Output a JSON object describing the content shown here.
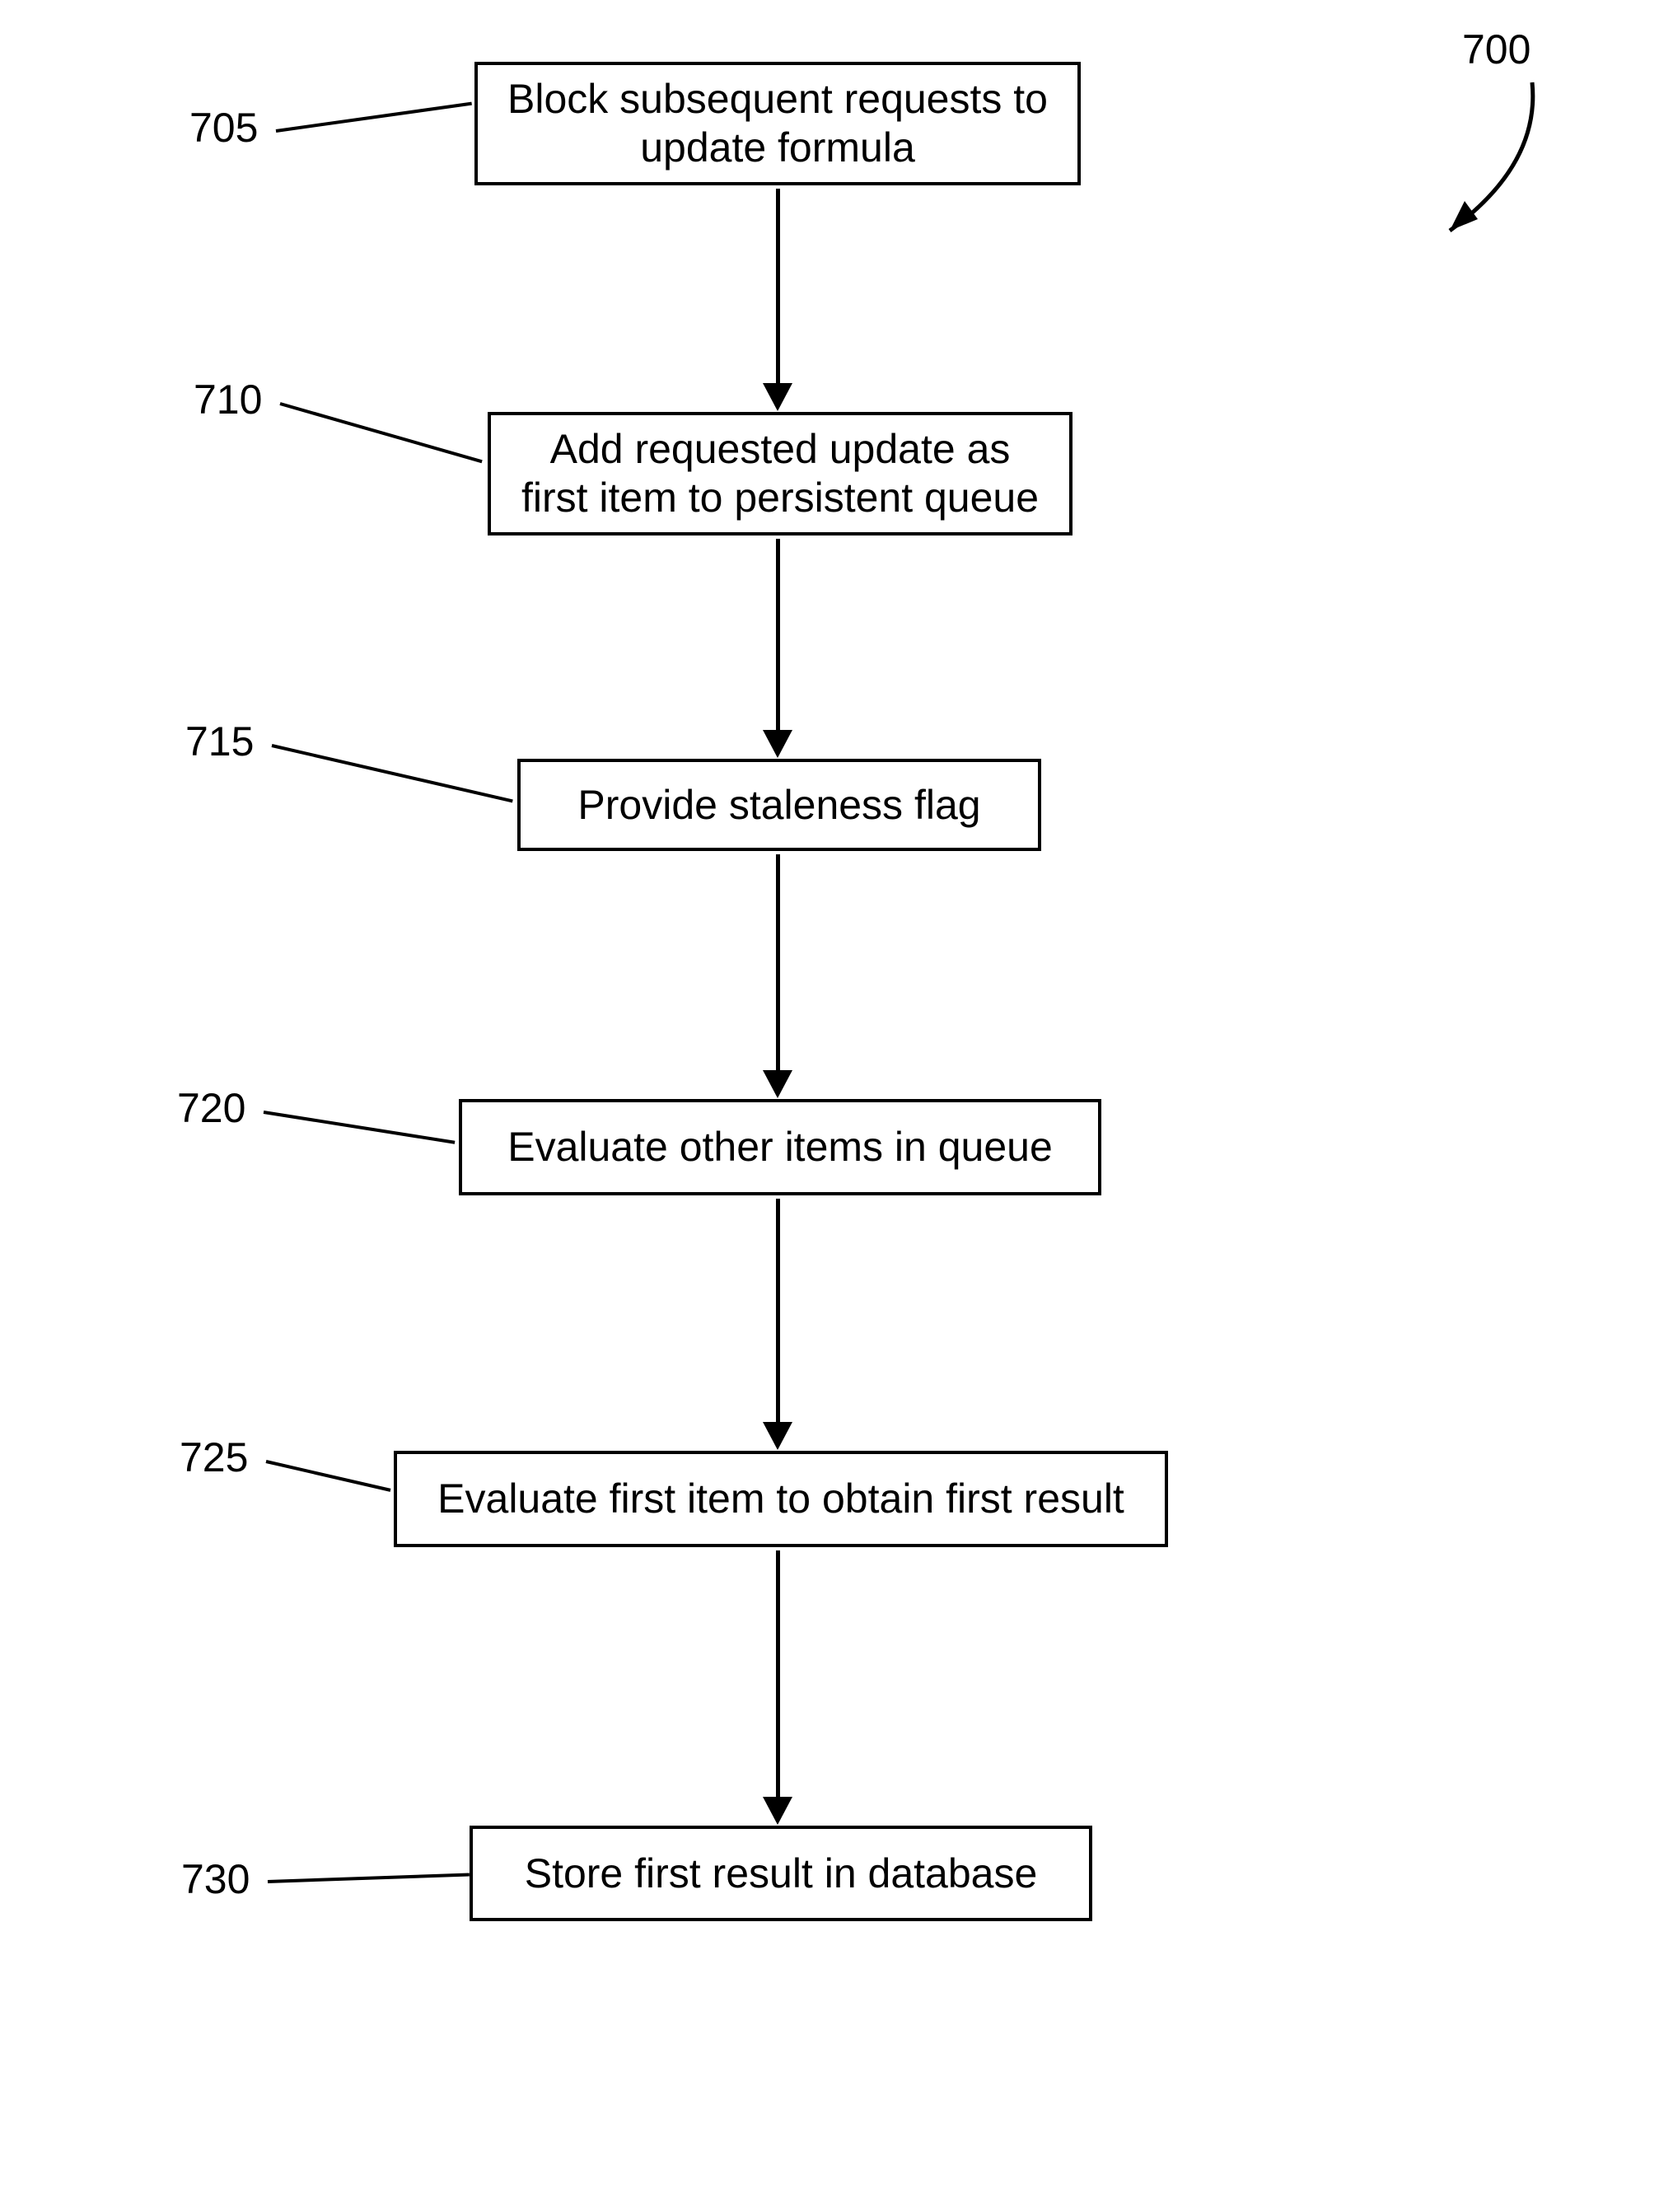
{
  "figure_label": "700",
  "steps": [
    {
      "id": "705",
      "text": "Block subsequent requests to\nupdate formula"
    },
    {
      "id": "710",
      "text": "Add requested update as\nfirst item to persistent queue"
    },
    {
      "id": "715",
      "text": "Provide staleness flag"
    },
    {
      "id": "720",
      "text": "Evaluate other items in queue"
    },
    {
      "id": "725",
      "text": "Evaluate first item to obtain first result"
    },
    {
      "id": "730",
      "text": "Store first result in database"
    }
  ]
}
